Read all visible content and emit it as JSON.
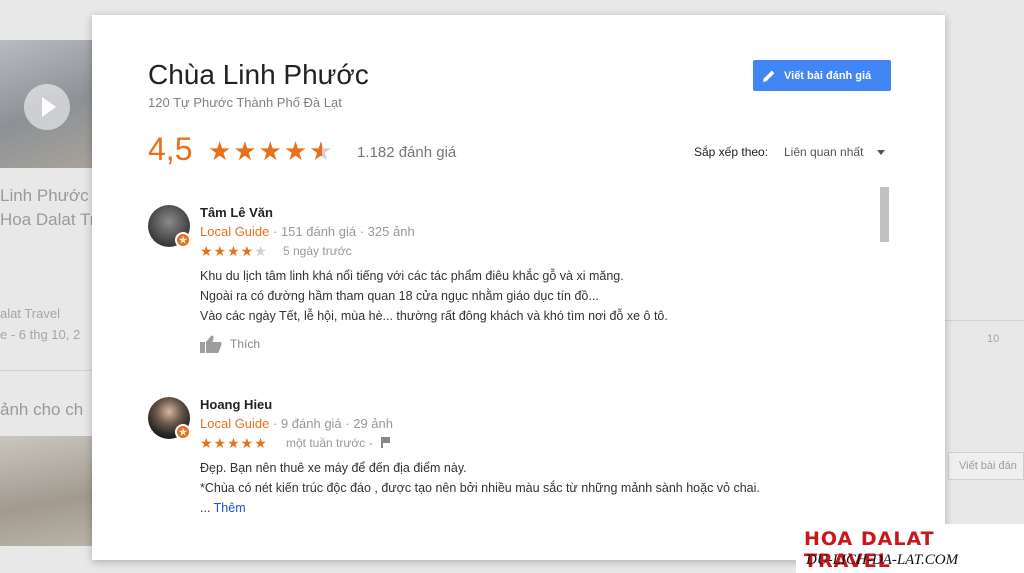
{
  "place": {
    "name": "Chùa Linh Phước",
    "address": "120 Tự Phước Thành Phố Đà Lạt",
    "rating": "4,5",
    "rating_value": 4.5,
    "review_count": "1.182 đánh giá",
    "write_review_label": "Viết bài đánh giá"
  },
  "sort": {
    "label": "Sắp xếp theo:",
    "value": "Liên quan nhất"
  },
  "reviews": [
    {
      "name": "Tâm Lê Văn",
      "badge": "Local Guide",
      "meta": " · 151 đánh giá · 325 ảnh",
      "stars": 4,
      "time": "5 ngày trước",
      "lines": [
        "Khu du lịch tâm linh khá nổi tiếng với các tác phẩm điêu khắc gỗ và xi măng.",
        "Ngoài ra có đường hầm tham quan 18 cửa ngục nhằm giáo dục tín đồ...",
        "Vào các ngày Tết, lễ hội, mùa hè... thường rất đông khách và khó tìm nơi đỗ xe ô tô."
      ],
      "like_label": "Thích"
    },
    {
      "name": "Hoang Hieu",
      "badge": "Local Guide",
      "meta": " · 9 đánh giá · 29 ảnh",
      "stars": 5,
      "time": "một tuần trước -",
      "lines": [
        "Đẹp. Bạn nên thuê xe máy để đến địa điểm này.",
        " *Chùa có nét kiến trúc độc đáo , được tạo nên bởi nhiều màu sắc từ những mảnh sành hoặc vỏ chai."
      ],
      "more_prefix": "... ",
      "more_label": "Thêm"
    }
  ],
  "background": {
    "title_fragment_1": "Linh Phước",
    "title_fragment_2": "Hoa Dalat Tr",
    "source_fragment": "alat Travel",
    "date_fragment": "e - 6 thg 10, 2",
    "section_fragment": "ảnh cho ch",
    "right_number": "10",
    "right_button": "Viết bài đán"
  },
  "watermark": {
    "title": "HOA DALAT TRAVEL",
    "subtitle": "DU-LICH-DA-LAT.COM"
  },
  "colors": {
    "accent": "#e7711b",
    "primary_button": "#4285f4",
    "link": "#1a55c8",
    "watermark_red": "#c8161d"
  }
}
